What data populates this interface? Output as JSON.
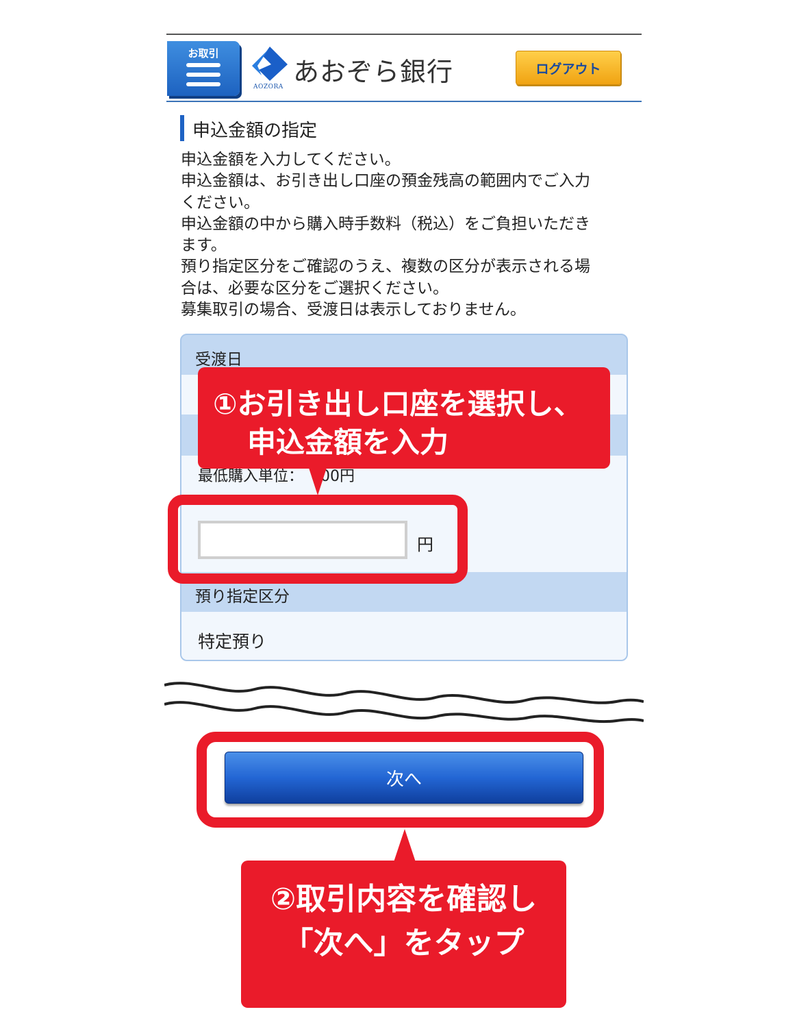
{
  "header": {
    "menu_label": "お取引",
    "logo_text": "あおぞら銀行",
    "logo_sub": "AOZORA",
    "logout_label": "ログアウト"
  },
  "section": {
    "title": "申込金額の指定",
    "instructions": [
      "申込金額を入力してください。",
      "申込金額は、お引き出し口座の預金残高の範囲内でご入力",
      "ください。",
      "申込金額の中から購入時手数料（税込）をご負担いただき",
      "ます。",
      "預り指定区分をご確認のうえ、複数の区分が表示される場",
      "合は、必要な区分をご選択ください。",
      "募集取引の場合、受渡日は表示しておりません。"
    ]
  },
  "form": {
    "delivery_date_label": "受渡日",
    "min_unit_text": "最低購入単位：　000円",
    "amount_value": "",
    "amount_unit": "円",
    "custody_label": "預り指定区分",
    "custody_value": "特定預り"
  },
  "callouts": {
    "step1_line1": "①お引き出し口座を選択し、",
    "step1_line2": "申込金額を入力",
    "step2_line1": "②取引内容を確認し",
    "step2_line2": "「次へ」をタップ"
  },
  "actions": {
    "next_label": "次へ"
  },
  "colors": {
    "accent_red": "#ea1b2a",
    "brand_blue": "#1e62c4",
    "logout_orange": "#f0a312",
    "panel_header": "#c2d8f2",
    "panel_body": "#f2f7fd"
  }
}
